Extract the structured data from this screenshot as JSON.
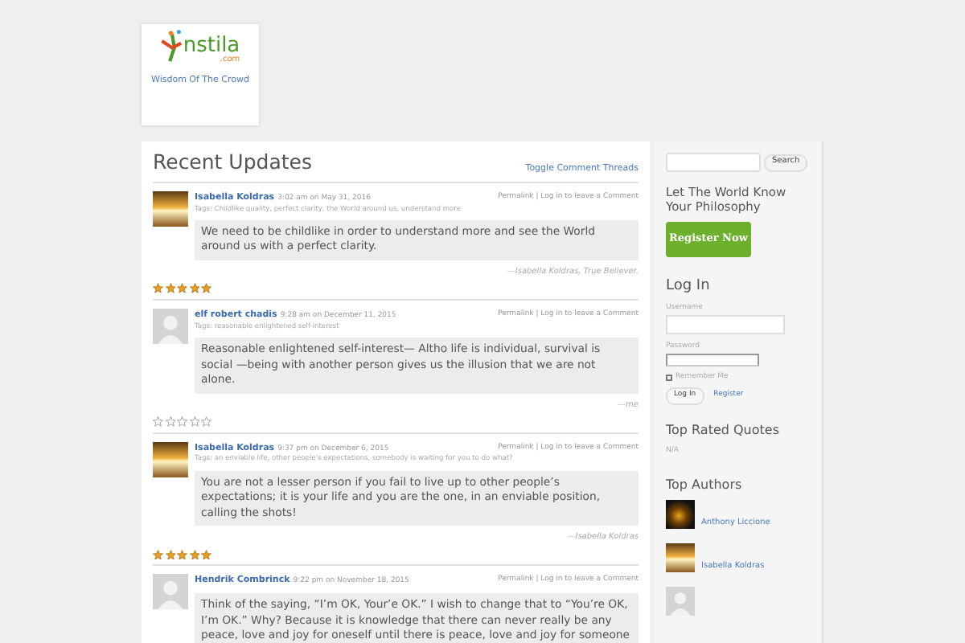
{
  "logo": {
    "name": "nstila",
    "domain": ".com",
    "tagline": "Wisdom Of The Crowd"
  },
  "main": {
    "title": "Recent Updates",
    "toggle": "Toggle Comment Threads",
    "posts": [
      {
        "kind": "photo",
        "author": "Isabella Koldras",
        "time": "3:02 am on May 31, 2016",
        "actions": "Permalink | Log in to leave a Comment",
        "tags": "Tags: Childlike quality, perfect clarity, the World around us, understand more",
        "quote": "We need to be childlike in order to understand more and see the World around us with a perfect clarity.",
        "attribution": "—Isabella Koldras, ",
        "attribution_role": "True Believer.",
        "stars": 5
      },
      {
        "kind": "default",
        "author": "elf robert chadis",
        "time": "9:28 am on December 11, 2015",
        "actions": "Permalink | Log in to leave a Comment",
        "tags": "Tags: reasonable enlightened self-interest",
        "quote": "Reasonable enlightened self-interest— Altho life is individual, survival is social —being with another person gives us the illusion that we are not alone.",
        "attribution": "—me",
        "stars": 0
      },
      {
        "kind": "photo",
        "author": "Isabella Koldras",
        "time": "9:37 pm on December 6, 2015",
        "actions": "Permalink | Log in to leave a Comment",
        "tags": "Tags: an enviable life, other people's expectations, somebody is waiting for you to do what?",
        "quote": "You are not a lesser person if you fail to live up to other people’s expectations; it is your life and you are the one, in an enviable position, calling the shots!",
        "attribution": "—Isabella Koldras",
        "stars": 5
      },
      {
        "kind": "default",
        "author": "Hendrik Combrinck",
        "time": "9:22 pm on November 18, 2015",
        "actions": "Permalink | Log in to leave a Comment",
        "quote": "Think of the saying, “I’m OK, Your’e OK.” I wish to change that to “You’re OK, I’m OK.” Why? Because it is knowledge that there can never really be any peace, love and joy for oneself until there is peace, love and joy for someone"
      }
    ]
  },
  "sidebar": {
    "search_button": "Search",
    "promo": "Let The World Know Your Philosophy",
    "register_button": "Register Now",
    "login": {
      "title": "Log In",
      "username_label": "Username",
      "password_label": "Password",
      "remember": {
        "label": "Remember Me",
        "checked": false
      },
      "login_button": "Log In",
      "register_link": "Register"
    },
    "top_rated": {
      "title": "Top Rated Quotes",
      "empty": "N/A"
    },
    "top_authors": {
      "title": "Top Authors",
      "authors": [
        {
          "name": "Anthony Liccione",
          "kind": "moon"
        },
        {
          "name": "Isabella Koldras",
          "kind": "photo"
        },
        {
          "kind": "default"
        }
      ]
    }
  }
}
